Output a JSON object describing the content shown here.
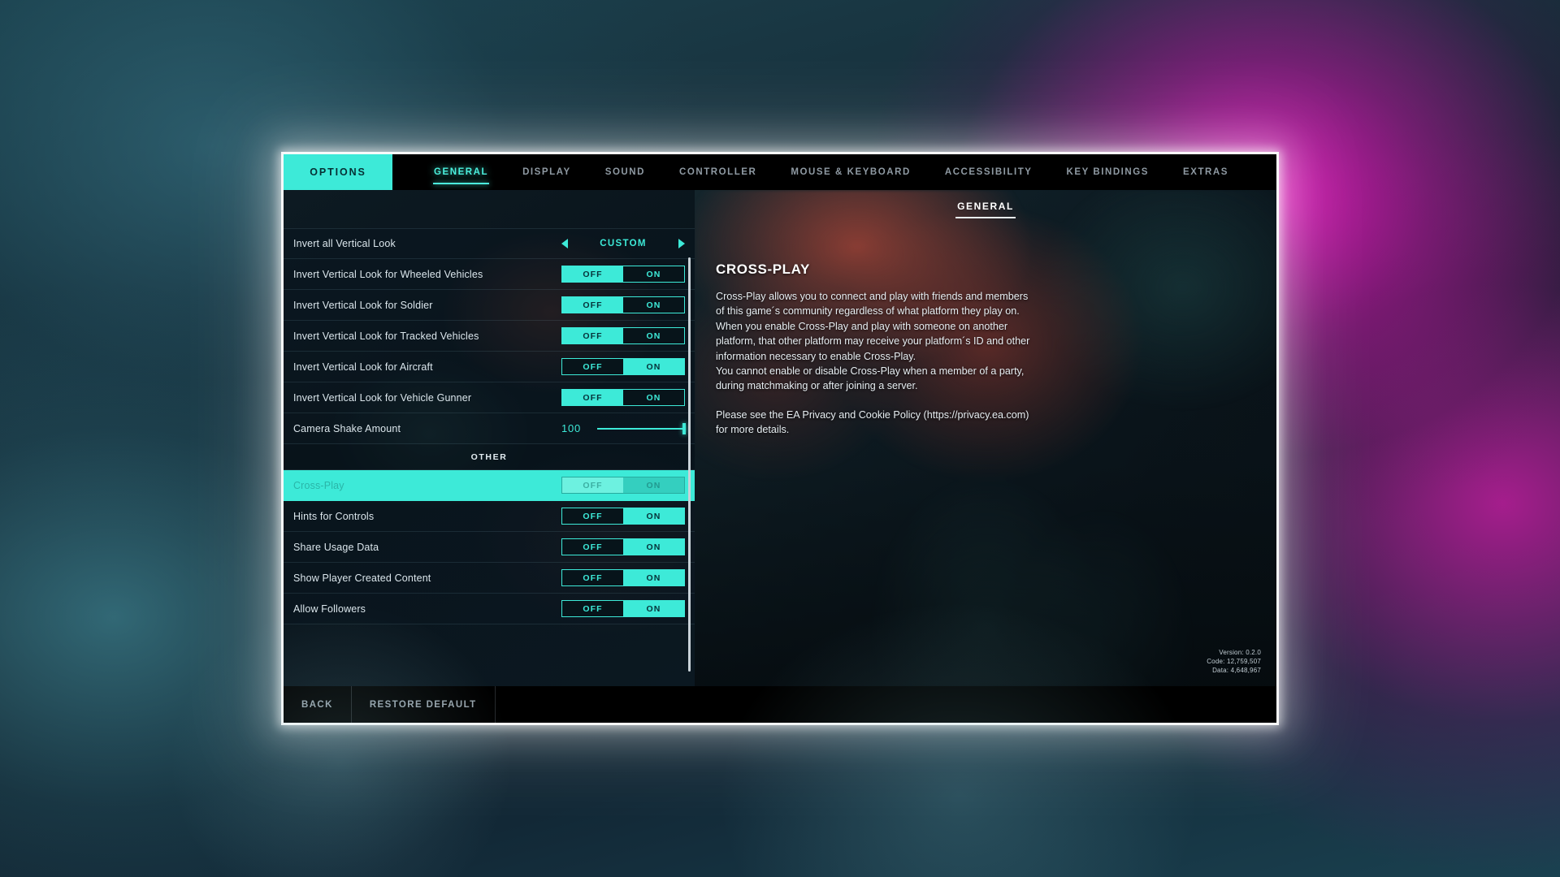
{
  "window": {
    "options_tab_label": "OPTIONS",
    "subheader_title": "GENERAL"
  },
  "tabs": [
    {
      "label": "GENERAL",
      "active": true
    },
    {
      "label": "DISPLAY",
      "active": false
    },
    {
      "label": "SOUND",
      "active": false
    },
    {
      "label": "CONTROLLER",
      "active": false
    },
    {
      "label": "MOUSE & KEYBOARD",
      "active": false
    },
    {
      "label": "ACCESSIBILITY",
      "active": false
    },
    {
      "label": "KEY BINDINGS",
      "active": false
    },
    {
      "label": "EXTRAS",
      "active": false
    }
  ],
  "settings": [
    {
      "type": "spinner",
      "label": "Invert all Vertical Look",
      "value": "CUSTOM",
      "selected": false
    },
    {
      "type": "toggle",
      "label": "Invert Vertical Look for Wheeled Vehicles",
      "off_label": "OFF",
      "on_label": "ON",
      "value": "OFF",
      "selected": false
    },
    {
      "type": "toggle",
      "label": "Invert Vertical Look for Soldier",
      "off_label": "OFF",
      "on_label": "ON",
      "value": "OFF",
      "selected": false
    },
    {
      "type": "toggle",
      "label": "Invert Vertical Look for Tracked Vehicles",
      "off_label": "OFF",
      "on_label": "ON",
      "value": "OFF",
      "selected": false
    },
    {
      "type": "toggle",
      "label": "Invert Vertical Look for Aircraft",
      "off_label": "OFF",
      "on_label": "ON",
      "value": "ON",
      "selected": false
    },
    {
      "type": "toggle",
      "label": "Invert Vertical Look for Vehicle Gunner",
      "off_label": "OFF",
      "on_label": "ON",
      "value": "OFF",
      "selected": false
    },
    {
      "type": "slider",
      "label": "Camera Shake Amount",
      "value": "100",
      "percent": 100,
      "selected": false
    },
    {
      "type": "section",
      "label": "OTHER"
    },
    {
      "type": "toggle",
      "label": "Cross-Play",
      "off_label": "OFF",
      "on_label": "ON",
      "value": "ON",
      "selected": true,
      "disabled": true
    },
    {
      "type": "toggle",
      "label": "Hints for Controls",
      "off_label": "OFF",
      "on_label": "ON",
      "value": "ON",
      "selected": false
    },
    {
      "type": "toggle",
      "label": "Share Usage Data",
      "off_label": "OFF",
      "on_label": "ON",
      "value": "ON",
      "selected": false
    },
    {
      "type": "toggle",
      "label": "Show Player Created Content",
      "off_label": "OFF",
      "on_label": "ON",
      "value": "ON",
      "selected": false
    },
    {
      "type": "toggle",
      "label": "Allow Followers",
      "off_label": "OFF",
      "on_label": "ON",
      "value": "ON",
      "selected": false
    }
  ],
  "description": {
    "title": "CROSS-PLAY",
    "paragraphs": [
      "Cross-Play allows you to connect and play with friends and members of this game´s community regardless of what platform they play on. When you enable Cross-Play and play with someone on another platform, that other platform may receive your platform´s ID and other information necessary to enable Cross-Play.\nYou cannot enable or disable Cross-Play when a member of a party, during matchmaking or after joining a server.",
      "Please see the EA Privacy and Cookie Policy (https://privacy.ea.com) for more details."
    ]
  },
  "version_info": {
    "version": "Version: 0.2.0",
    "code": "Code: 12,759,507",
    "data": "Data: 4,648,967"
  },
  "bottom_buttons": [
    {
      "label": "BACK"
    },
    {
      "label": "RESTORE DEFAULT"
    }
  ],
  "colors": {
    "accent_cyan": "#3dead8",
    "tab_active": "#4bf0dd",
    "panel_dark": "#070d12"
  }
}
